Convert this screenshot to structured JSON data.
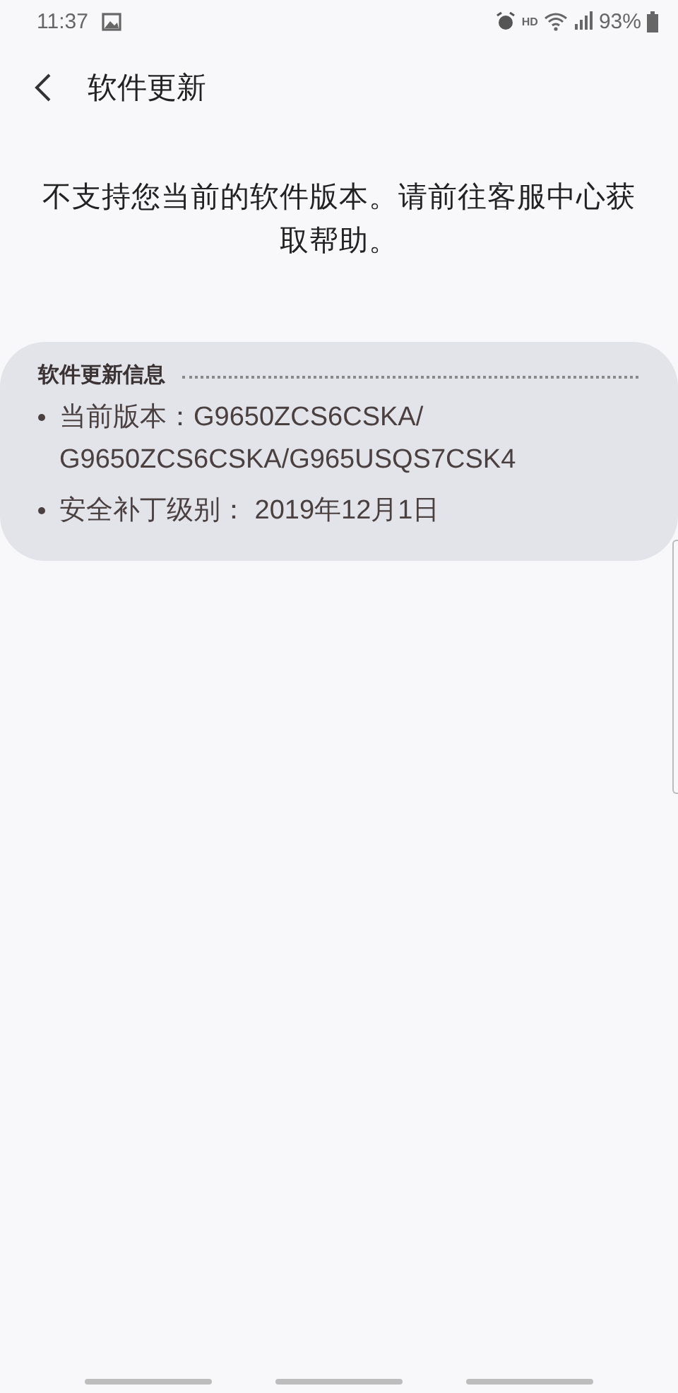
{
  "status_bar": {
    "time": "11:37",
    "hd": "HD",
    "battery": "93%"
  },
  "header": {
    "title": "软件更新"
  },
  "message": "不支持您当前的软件版本。请前往客服中心获取帮助。",
  "info_card": {
    "title": "软件更新信息",
    "items": [
      {
        "lines": [
          "当前版本：G9650ZCS6CSKA/",
          "G9650ZCS6CSKA/G965USQS7CSK4"
        ]
      },
      {
        "lines": [
          "安全补丁级别： 2019年12月1日"
        ]
      }
    ]
  }
}
